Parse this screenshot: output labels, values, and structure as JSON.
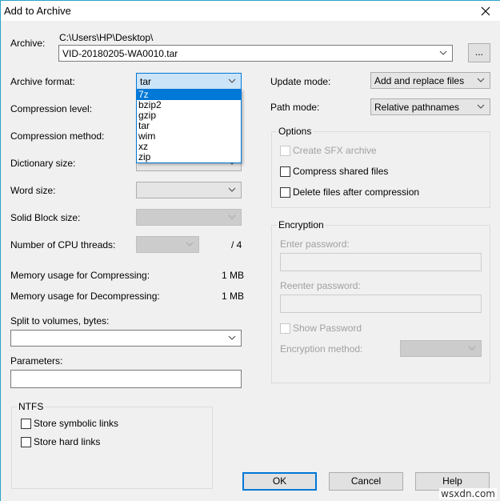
{
  "window": {
    "title": "Add to Archive",
    "close_icon": "close-icon"
  },
  "archive": {
    "label": "Archive:",
    "path": "C:\\Users\\HP\\Desktop\\",
    "filename": "VID-20180205-WA0010.tar",
    "browse_label": "..."
  },
  "left": {
    "archive_format": {
      "label": "Archive format:",
      "value": "tar",
      "options": [
        "7z",
        "bzip2",
        "gzip",
        "tar",
        "wim",
        "xz",
        "zip"
      ],
      "highlighted": "7z"
    },
    "compression_level": {
      "label": "Compression level:"
    },
    "compression_method": {
      "label": "Compression method:"
    },
    "dictionary_size": {
      "label": "Dictionary size:"
    },
    "word_size": {
      "label": "Word size:"
    },
    "solid_block_size": {
      "label": "Solid Block size:"
    },
    "cpu_threads": {
      "label": "Number of CPU threads:",
      "total": "/ 4"
    },
    "mem_compress": {
      "label": "Memory usage for Compressing:",
      "value": "1 MB"
    },
    "mem_decompress": {
      "label": "Memory usage for Decompressing:",
      "value": "1 MB"
    },
    "split_volumes": {
      "label": "Split to volumes, bytes:",
      "value": ""
    },
    "parameters": {
      "label": "Parameters:",
      "value": ""
    },
    "ntfs": {
      "title": "NTFS",
      "store_symbolic_links": {
        "label": "Store symbolic links",
        "checked": false
      },
      "store_hard_links": {
        "label": "Store hard links",
        "checked": false
      }
    }
  },
  "right": {
    "update_mode": {
      "label": "Update mode:",
      "value": "Add and replace files"
    },
    "path_mode": {
      "label": "Path mode:",
      "value": "Relative pathnames"
    },
    "options": {
      "title": "Options",
      "create_sfx": {
        "label": "Create SFX archive",
        "checked": false,
        "enabled": false
      },
      "compress_shared": {
        "label": "Compress shared files",
        "checked": false
      },
      "delete_after": {
        "label": "Delete files after compression",
        "checked": false
      }
    },
    "encryption": {
      "title": "Encryption",
      "enter_password": {
        "label": "Enter password:",
        "value": ""
      },
      "reenter_password": {
        "label": "Reenter password:",
        "value": ""
      },
      "show_password": {
        "label": "Show Password",
        "checked": false
      },
      "encryption_method": {
        "label": "Encryption method:",
        "value": ""
      }
    }
  },
  "buttons": {
    "ok": "OK",
    "cancel": "Cancel",
    "help": "Help"
  },
  "watermark": "wsxdn.com",
  "colors": {
    "accent": "#0078d7",
    "window_border": "#2ba4c6",
    "background": "#f0f0f0"
  }
}
